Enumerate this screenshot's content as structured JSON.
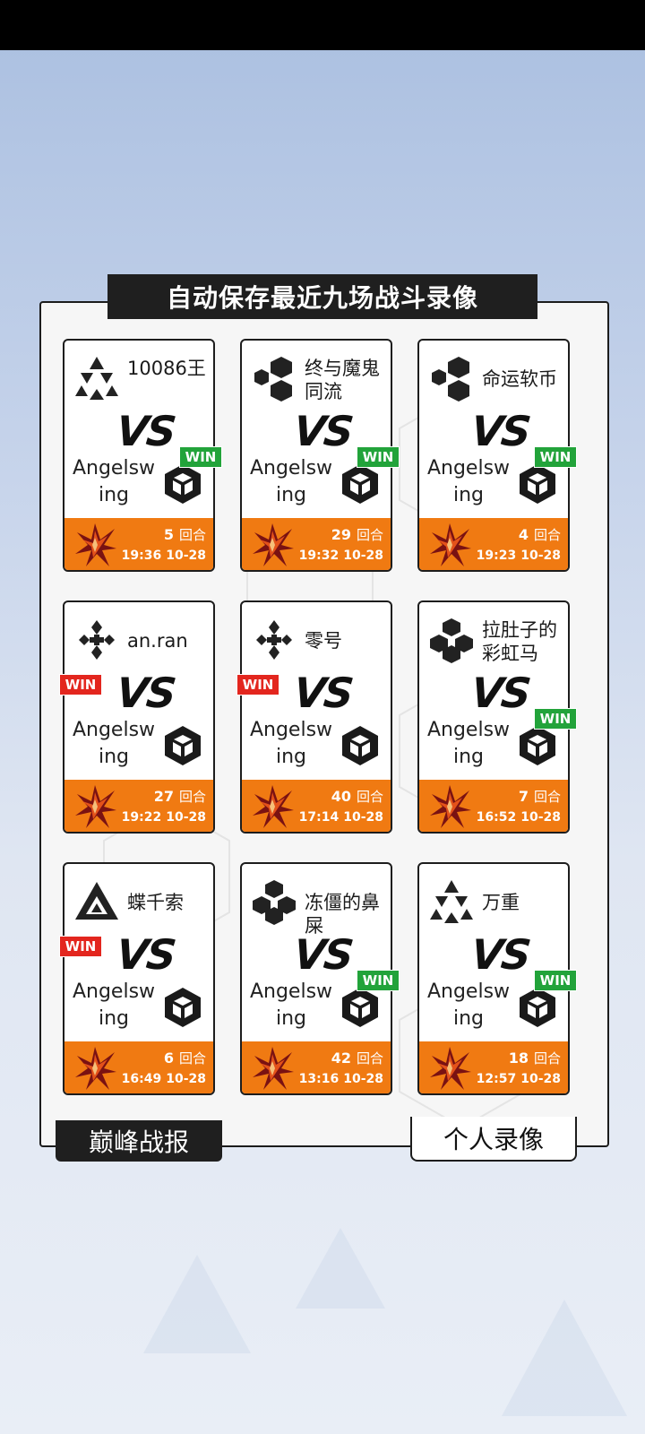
{
  "header": {
    "title": "自动保存最近九场战斗录像"
  },
  "tabs": [
    {
      "label": "巅峰战报",
      "active": false
    },
    {
      "label": "个人录像",
      "active": true
    }
  ],
  "colors": {
    "orange": "#f07a12",
    "win_green": "#22a33a",
    "win_red": "#e3261e",
    "dark": "#1f1f1f"
  },
  "matches": [
    {
      "opponent": "10086王",
      "opponent_icon": "triangle-cluster-icon",
      "vs": "VS",
      "player": "Angelswing",
      "player_icon": "cube-icon",
      "win": "WIN",
      "win_side": "player",
      "rounds": "5",
      "rounds_unit": "回合",
      "time": "19:36",
      "date": "10-28"
    },
    {
      "opponent": "终与魔鬼同流",
      "opponent_icon": "hexagon-cluster-icon",
      "vs": "VS",
      "player": "Angelswing",
      "player_icon": "cube-icon",
      "win": "WIN",
      "win_side": "player",
      "rounds": "29",
      "rounds_unit": "回合",
      "time": "19:32",
      "date": "10-28"
    },
    {
      "opponent": "命运软币",
      "opponent_icon": "hexagon-cluster-icon",
      "vs": "VS",
      "player": "Angelswing",
      "player_icon": "cube-icon",
      "win": "WIN",
      "win_side": "player",
      "rounds": "4",
      "rounds_unit": "回合",
      "time": "19:23",
      "date": "10-28"
    },
    {
      "opponent": "an.ran",
      "opponent_icon": "diamond-cross-icon",
      "vs": "VS",
      "player": "Angelswing",
      "player_icon": "cube-icon",
      "win": "WIN",
      "win_side": "opponent",
      "rounds": "27",
      "rounds_unit": "回合",
      "time": "19:22",
      "date": "10-28"
    },
    {
      "opponent": "零号",
      "opponent_icon": "diamond-cross-icon",
      "vs": "VS",
      "player": "Angelswing",
      "player_icon": "cube-icon",
      "win": "WIN",
      "win_side": "opponent",
      "rounds": "40",
      "rounds_unit": "回合",
      "time": "17:14",
      "date": "10-28"
    },
    {
      "opponent": "拉肚子的彩虹马",
      "opponent_icon": "hexagon-flower-icon",
      "vs": "VS",
      "player": "Angelswing",
      "player_icon": "cube-icon",
      "win": "WIN",
      "win_side": "player",
      "rounds": "7",
      "rounds_unit": "回合",
      "time": "16:52",
      "date": "10-28"
    },
    {
      "opponent": "蝶千索",
      "opponent_icon": "triangle-emblem-icon",
      "vs": "VS",
      "player": "Angelswing",
      "player_icon": "cube-icon",
      "win": "WIN",
      "win_side": "opponent",
      "rounds": "6",
      "rounds_unit": "回合",
      "time": "16:49",
      "date": "10-28"
    },
    {
      "opponent": "冻僵的鼻屎",
      "opponent_icon": "hexagon-flower-icon",
      "vs": "VS",
      "player": "Angelswing",
      "player_icon": "cube-icon",
      "win": "WIN",
      "win_side": "player",
      "rounds": "42",
      "rounds_unit": "回合",
      "time": "13:16",
      "date": "10-28"
    },
    {
      "opponent": "万重",
      "opponent_icon": "triangle-cluster-icon",
      "vs": "VS",
      "player": "Angelswing",
      "player_icon": "cube-icon",
      "win": "WIN",
      "win_side": "player",
      "rounds": "18",
      "rounds_unit": "回合",
      "time": "12:57",
      "date": "10-28"
    }
  ]
}
